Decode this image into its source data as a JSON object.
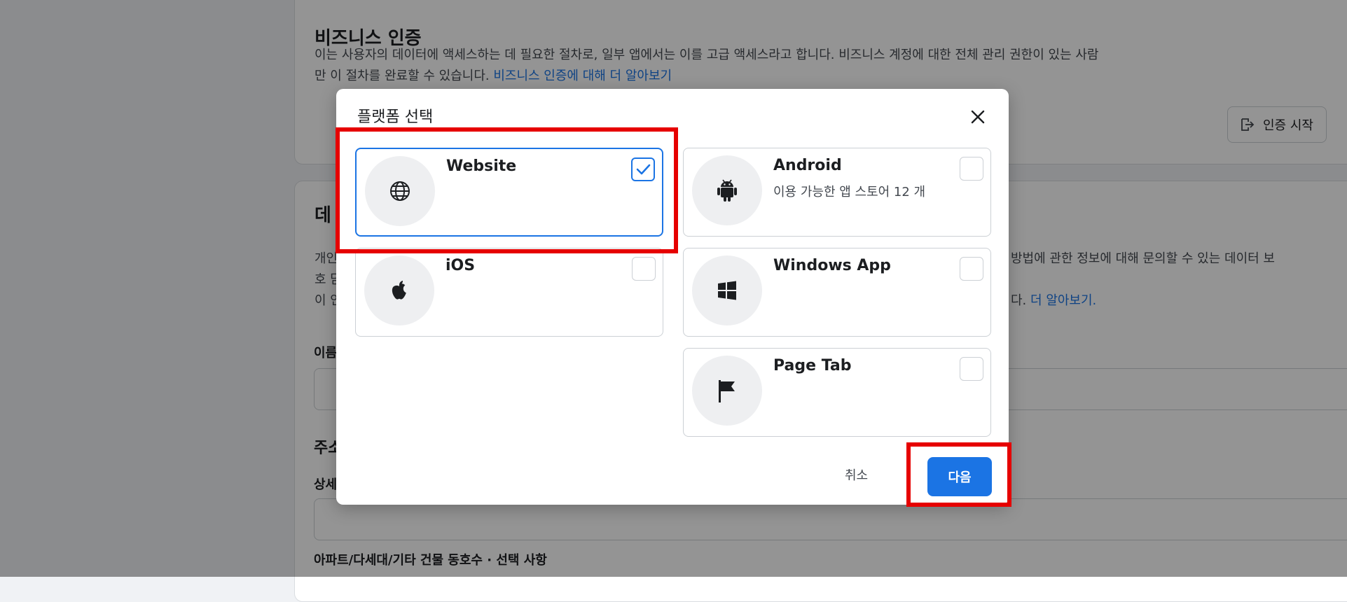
{
  "biz": {
    "title": "비즈니스 인증",
    "desc_line1": "이는 사용자의 데이터에 액세스하는 데 필요한 절차로, 일부 앱에서는 이를 고급 액세스라고 합니다. 비즈니스 계정에 대한 전체 관리 권한이 있는 사람",
    "desc_line2": "만 이 절차를 완료할 수 있습니다.",
    "learn_more": "비즈니스 인증에 대해 더 알아보기",
    "start_button": "인증 시작"
  },
  "data_section": {
    "title_partial": "데",
    "text_l1_partial": "개인",
    "text_l2_partial": "호 담",
    "text_l3_partial": "이 인",
    "right_l1": "방법에 관한 정보에 대해 문의할 수 있는 데이터 보",
    "right_l3": "다.",
    "learn_more": "더 알아보기.",
    "name_label_partial": "이름",
    "address_label_partial": "주소",
    "detail_label_partial": "상세",
    "apartment_label": "아파트/다세대/기타 건물 동호수 · 선택 사항"
  },
  "modal": {
    "title": "플랫폼 선택",
    "options": [
      {
        "name": "Website",
        "sub": "",
        "selected": true
      },
      {
        "name": "Android",
        "sub": "이용 가능한 앱 스토어 12 개",
        "selected": false
      },
      {
        "name": "iOS",
        "sub": "",
        "selected": false
      },
      {
        "name": "Windows App",
        "sub": "",
        "selected": false
      },
      {
        "name": "Page Tab",
        "sub": "",
        "selected": false
      }
    ],
    "cancel": "취소",
    "next": "다음"
  },
  "colors": {
    "accent": "#1b74e4",
    "highlight": "#e60000",
    "overlay": "rgba(0,0,0,0.42)"
  }
}
